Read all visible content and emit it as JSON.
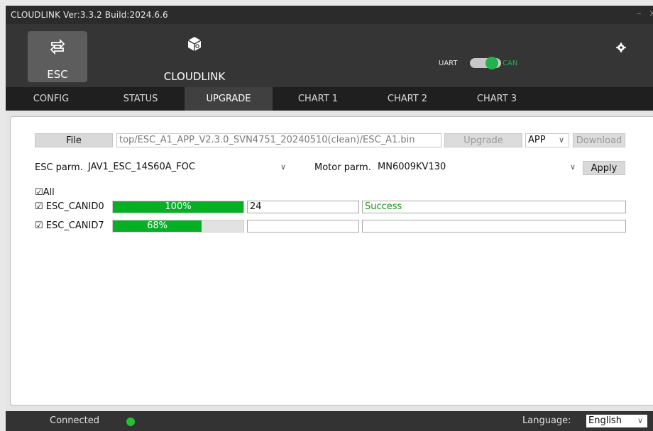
{
  "window": {
    "title": "CLOUDLINK   Ver:3.3.2  Build:2024.6.6",
    "minimize": "–",
    "close": "×"
  },
  "nav": {
    "esc_label": "ESC",
    "esc_icon": "transfer-icon",
    "cloudlink_label": "CLOUDLINK",
    "cloudlink_icon": "box-icon"
  },
  "protocol": {
    "left": "UART",
    "right": "CAN",
    "selected": "CAN"
  },
  "settings_icon": "gear-icon",
  "tabs": [
    {
      "label": "CONFIG"
    },
    {
      "label": "STATUS"
    },
    {
      "label": "UPGRADE",
      "active": true
    },
    {
      "label": "CHART 1"
    },
    {
      "label": "CHART 2"
    },
    {
      "label": "CHART 3"
    }
  ],
  "upgrade": {
    "file_button": "File",
    "file_path": "top/ESC_A1_APP_V2.3.0_SVN4751_20240510(clean)/ESC_A1.bin",
    "upgrade_button": "Upgrade",
    "mode_select": "APP",
    "download_button": "Download",
    "esc_parm_label": "ESC parm.",
    "esc_parm_value": "JAV1_ESC_14S60A_FOC",
    "motor_parm_label": "Motor parm.",
    "motor_parm_value": "MN6009KV130",
    "apply_button": "Apply",
    "all_checkbox": "☑All",
    "devices": [
      {
        "label": "☑ ESC_CANID0",
        "progress": 100,
        "progress_text": "100%",
        "value": "24",
        "status": "Success"
      },
      {
        "label": "☑ ESC_CANID7",
        "progress": 68,
        "progress_text": "68%",
        "value": "",
        "status": ""
      }
    ]
  },
  "footer": {
    "status": "Connected",
    "status_color": "#22c232",
    "language_label": "Language:",
    "language_value": "English"
  },
  "colors": {
    "progress": "#06b025",
    "success_text": "#1a8f1a",
    "can_accent": "#22b14c"
  }
}
